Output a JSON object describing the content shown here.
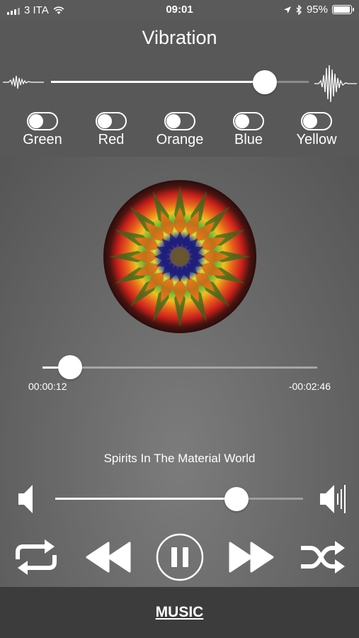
{
  "status": {
    "carrier": "3 ITA",
    "time": "09:01",
    "battery": "95%",
    "battery_level": 0.95
  },
  "header": {
    "title": "Vibration",
    "vibration_level": 0.83
  },
  "toggles": [
    {
      "label": "Green",
      "on": false
    },
    {
      "label": "Red",
      "on": false
    },
    {
      "label": "Orange",
      "on": false
    },
    {
      "label": "Blue",
      "on": false
    },
    {
      "label": "Yellow",
      "on": false
    }
  ],
  "player": {
    "elapsed": "00:00:12",
    "remaining": "-00:02:46",
    "progress": 0.1,
    "song_title": "Spirits In The Material World",
    "volume": 0.73
  },
  "controls": {
    "repeat": "repeat-icon",
    "rewind": "rewind-icon",
    "pause": "pause-icon",
    "forward": "fast-forward-icon",
    "shuffle": "shuffle-icon"
  },
  "bottom": {
    "tab_label": "MUSIC"
  },
  "colors": {
    "header_bg": "#585858",
    "bottom_bg": "#3c3c3c",
    "accent": "#ffffff"
  }
}
